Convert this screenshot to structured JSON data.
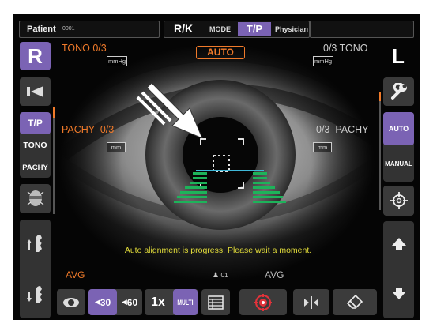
{
  "topbar": {
    "patient_label": "Patient",
    "patient_id": "0001",
    "rk_label": "R/K",
    "mode_label": "MODE",
    "tp_label": "T/P",
    "physician_label": "Physician"
  },
  "left_eye_side": "R",
  "right_eye_side": "L",
  "tono_left": "TONO 0/3",
  "tono_right": "0/3 TONO",
  "pachy_left": "PACHY  0/3",
  "pachy_right": "0/3  PACHY",
  "unit_mmhg": "mmHg",
  "unit_mm": "mm",
  "auto_badge": "AUTO",
  "left_panel": {
    "tp": "T/P",
    "tono": "TONO",
    "pachy": "PACHY"
  },
  "right_panel": {
    "auto": "AUTO",
    "manual": "MANUAL"
  },
  "status_message": "Auto alignment is progress. Please wait a moment.",
  "avg_left": "AVG",
  "avg_right": "AVG",
  "counter": "01",
  "bottom": {
    "btn30": "30",
    "btn60": "60",
    "btn1x": "1x",
    "multi": "MULTI"
  },
  "colors": {
    "accent": "#7b63b4",
    "orange": "#f07a2a",
    "green": "#1db35a",
    "cyan": "#3fb8d8"
  }
}
